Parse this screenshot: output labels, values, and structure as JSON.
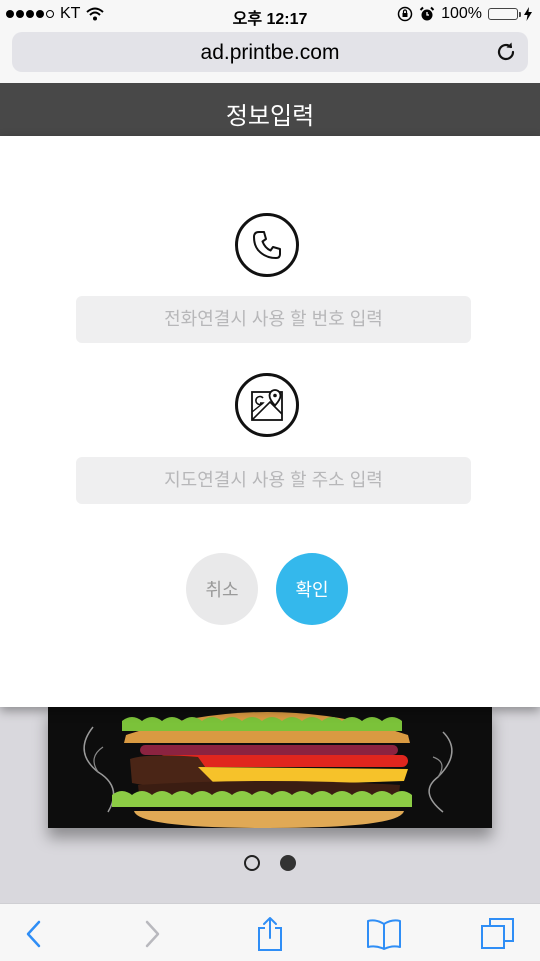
{
  "status_bar": {
    "carrier": "KT",
    "time": "오후 12:17",
    "battery": "100%",
    "battery_level": 1.0
  },
  "browser": {
    "url": "ad.printbe.com"
  },
  "dialog": {
    "title": "정보입력",
    "phone_placeholder": "전화연결시 사용 할 번호 입력",
    "map_placeholder": "지도연결시 사용 할 주소 입력",
    "cancel_label": "취소",
    "confirm_label": "확인"
  },
  "carousel": {
    "page_count": 2,
    "active_page": 2
  },
  "colors": {
    "header": "#484848",
    "confirm": "#34b8ec",
    "cancel": "#e9e9ea",
    "ios_blue": "#2f8ef6"
  },
  "icons": {
    "phone": "phone-icon",
    "map": "map-pin-icon",
    "reload": "reload-icon",
    "back": "back-arrow-icon",
    "forward": "forward-arrow-icon",
    "share": "share-icon",
    "bookmarks": "bookmarks-icon",
    "tabs": "tabs-icon"
  }
}
